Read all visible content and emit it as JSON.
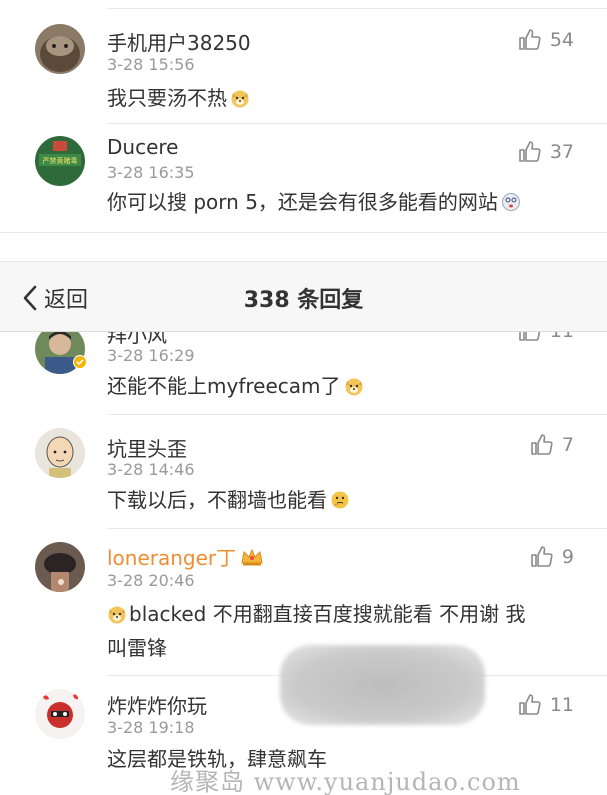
{
  "top_comments": [
    {
      "name": "手机用户38250",
      "time": "3-28 15:56",
      "text": "我只要汤不热",
      "emoji": "doge-emoji",
      "likes": "54"
    },
    {
      "name": "Ducere",
      "time": "3-28 16:35",
      "text": "你可以搜 porn 5，还是会有很多能看的网站",
      "emoji": "dizzy-emoji",
      "likes": "37",
      "avatar_sign": "严禁黄赌毒"
    }
  ],
  "navbar": {
    "back_label": "返回",
    "title": "338 条回复"
  },
  "partial_comment": {
    "likes": "11"
  },
  "comments": [
    {
      "name": "拜小风",
      "time": "3-28 16:29",
      "text": "还能不能上myfreecam了",
      "emoji": "doge-emoji"
    },
    {
      "name": "坑里头歪",
      "time": "3-28 14:46",
      "text": "下载以后，不翻墙也能看",
      "emoji": "thinking-emoji",
      "likes": "7"
    },
    {
      "name": "loneranger丁",
      "time": "3-28 20:46",
      "text_line1": "blacked 不用翻直接百度搜就能看 不用谢 我",
      "text_line2": "叫雷锋",
      "emoji": "doge-emoji",
      "badge": "crown-badge",
      "likes": "9"
    },
    {
      "name": "炸炸炸你玩",
      "time": "3-28 19:18",
      "text": "这层都是铁轨，肆意飙车",
      "likes": "11"
    }
  ],
  "watermark": "缘聚岛 www.yuanjudao.com",
  "colors": {
    "orange_name": "#f08d33",
    "gray_text": "#9a9a9a",
    "divider": "#e8e8e8"
  }
}
